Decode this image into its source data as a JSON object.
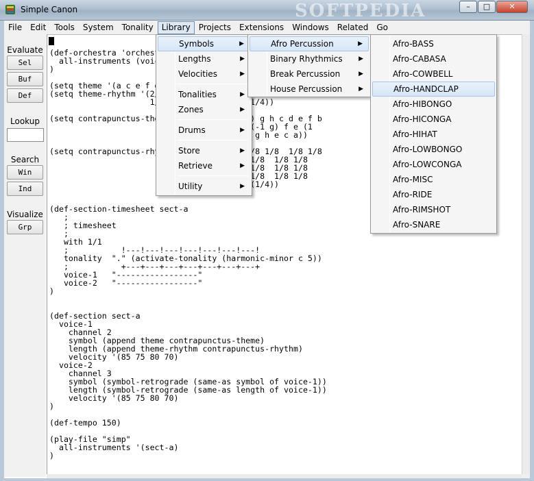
{
  "window": {
    "title": "Simple Canon",
    "watermark": "SOFTPEDIA",
    "controls": {
      "minimize": "–",
      "maximize": "□",
      "close": "✕"
    }
  },
  "menubar": {
    "items": [
      {
        "label": "File"
      },
      {
        "label": "Edit"
      },
      {
        "label": "Tools"
      },
      {
        "label": "System"
      },
      {
        "label": "Tonality"
      },
      {
        "label": "Library"
      },
      {
        "label": "Projects"
      },
      {
        "label": "Extensions"
      },
      {
        "label": "Windows"
      },
      {
        "label": "Related"
      },
      {
        "label": "Go"
      }
    ],
    "active": "Library"
  },
  "sidebar": {
    "evaluate_label": "Evaluate",
    "sel": "Sel",
    "buf": "Buf",
    "def": "Def",
    "lookup_label": "Lookup",
    "search_label": "Search",
    "win": "Win",
    "ind": "Ind",
    "visualize_label": "Visualize",
    "grp": "Grp"
  },
  "editor": {
    "code": "(def-orchestra 'orchestra\n  all-instruments (voice-1 voice-2))\n)\n\n(setq theme '(a c e f g h i j k l m n o))\n(setq theme-rhythm '(2/4 1/4 1/4 1/4 1/4 1/4 1/4 1/4 1/4\n                     1/4 1/4 1/4 1/4 1/4 (1/4))\n\n(setq contrapunctus-theme '(a b c d e (1 f) g h c d e f b\n                          (-1 g) h (-1 i) (-1 g) f e (1\n                          f) g h g k j i h g h e c a))\n\n(setq contrapunctus-rhythm '(1/8 1/8 1/8 1/8 1/8  1/8 1/8\n                          1/8 1/8 1/8 1/8 1/8  1/8 1/8\n                          1/8 1/8 1/8 1/8 1/8  1/8 1/8\n                          1/8 1/8 1/8 1/8 1/8  1/8 1/8\n                          1/8 1/8 1/8 1/8 (1/4))\n\n\n(def-section-timesheet sect-a\n   ;\n   ; timesheet\n   ;\n   with 1/1\n   ;           !---!---!---!---!---!---!---!\n   tonality  \".\" (activate-tonality (harmonic-minor c 5))\n   ;           +---+---+---+---+---+---+---+\n   voice-1   \"-----------------\"\n   voice-2   \"-----------------\"\n)\n\n\n(def-section sect-a\n  voice-1\n    channel 2\n    symbol (append theme contrapunctus-theme)\n    length (append theme-rhythm contrapunctus-rhythm)\n    velocity '(85 75 80 70)\n  voice-2\n    channel 3\n    symbol (symbol-retrograde (same-as symbol of voice-1))\n    length (symbol-retrograde (same-as length of voice-1))\n    velocity '(85 75 80 70)\n)\n\n(def-tempo 150)\n\n(play-file \"simp\"\n  all-instruments '(sect-a)\n)"
  },
  "library_menu": {
    "items": [
      {
        "label": "Symbols",
        "submenu": true
      },
      {
        "label": "Lengths",
        "submenu": true
      },
      {
        "label": "Velocities",
        "submenu": true
      },
      {
        "label": "Tonalities",
        "submenu": true
      },
      {
        "label": "Zones",
        "submenu": true
      },
      {
        "label": "Drums",
        "submenu": true
      },
      {
        "label": "Store",
        "submenu": true
      },
      {
        "label": "Retrieve",
        "submenu": true
      },
      {
        "label": "Utility",
        "submenu": true
      }
    ],
    "arrow": "▶"
  },
  "symbols_menu": {
    "items": [
      {
        "label": "Afro Percussion"
      },
      {
        "label": "Binary Rhythmics"
      },
      {
        "label": "Break Percussion"
      },
      {
        "label": "House Percussion"
      }
    ]
  },
  "afro_menu": {
    "items": [
      {
        "label": "Afro-BASS"
      },
      {
        "label": "Afro-CABASA"
      },
      {
        "label": "Afro-COWBELL"
      },
      {
        "label": "Afro-HANDCLAP"
      },
      {
        "label": "Afro-HIBONGO"
      },
      {
        "label": "Afro-HICONGA"
      },
      {
        "label": "Afro-HIHAT"
      },
      {
        "label": "Afro-LOWBONGO"
      },
      {
        "label": "Afro-LOWCONGA"
      },
      {
        "label": "Afro-MISC"
      },
      {
        "label": "Afro-RIDE"
      },
      {
        "label": "Afro-RIMSHOT"
      },
      {
        "label": "Afro-SNARE"
      }
    ],
    "highlighted": "Afro-HANDCLAP"
  },
  "colors": {
    "highlight": "#d6e6f7",
    "menu_bg": "#f5f5f5",
    "titlebar": "#aebfd0"
  }
}
